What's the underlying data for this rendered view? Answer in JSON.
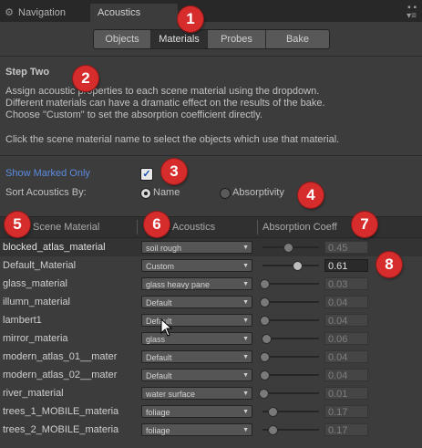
{
  "tabs": {
    "navigation": "Navigation",
    "acoustics": "Acoustics"
  },
  "toolbar": [
    "Objects",
    "Materials",
    "Probes",
    "Bake"
  ],
  "toolbar_selected": "Materials",
  "step": {
    "title": "Step Two",
    "lines": [
      "Assign acoustic properties to each scene material using the dropdown.",
      "Different materials can have a dramatic effect on the results of the bake.",
      "Choose \"Custom\" to set the absorption coefficient directly."
    ],
    "hint": "Click the scene material name to select the objects which use that material."
  },
  "options": {
    "show_marked_label": "Show Marked Only",
    "show_marked_checked": true,
    "sort_label": "Sort Acoustics By:",
    "sort_name": "Name",
    "sort_absorptivity": "Absorptivity",
    "sort_selected": "Name"
  },
  "columns": {
    "scene_material": "Scene Material",
    "acoustics": "Acoustics",
    "absorption": "Absorption Coeff"
  },
  "rows": [
    {
      "name": "blocked_atlas_material",
      "acoustics": "soil rough",
      "coeff": "0.45",
      "slider": 0.45,
      "editable": false,
      "selected": true
    },
    {
      "name": "Default_Material",
      "acoustics": "Custom",
      "coeff": "0.61",
      "slider": 0.61,
      "editable": true,
      "selected": false
    },
    {
      "name": "glass_material",
      "acoustics": "glass heavy pane",
      "coeff": "0.03",
      "slider": 0.03,
      "editable": false,
      "selected": false
    },
    {
      "name": "illumn_material",
      "acoustics": "Default",
      "coeff": "0.04",
      "slider": 0.04,
      "editable": false,
      "selected": false
    },
    {
      "name": "lambert1",
      "acoustics": "Default",
      "coeff": "0.04",
      "slider": 0.04,
      "editable": false,
      "selected": false
    },
    {
      "name": "mirror_materia",
      "acoustics": "glass",
      "coeff": "0.06",
      "slider": 0.06,
      "editable": false,
      "selected": false
    },
    {
      "name": "modern_atlas_01__mater",
      "acoustics": "Default",
      "coeff": "0.04",
      "slider": 0.04,
      "editable": false,
      "selected": false
    },
    {
      "name": "modern_atlas_02__mater",
      "acoustics": "Default",
      "coeff": "0.04",
      "slider": 0.04,
      "editable": false,
      "selected": false
    },
    {
      "name": "river_material",
      "acoustics": "water surface",
      "coeff": "0.01",
      "slider": 0.01,
      "editable": false,
      "selected": false
    },
    {
      "name": "trees_1_MOBILE_materia",
      "acoustics": "foliage",
      "coeff": "0.17",
      "slider": 0.17,
      "editable": false,
      "selected": false
    },
    {
      "name": "trees_2_MOBILE_materia",
      "acoustics": "foliage",
      "coeff": "0.17",
      "slider": 0.17,
      "editable": false,
      "selected": false
    }
  ],
  "callouts": [
    "1",
    "2",
    "3",
    "4",
    "5",
    "6",
    "7",
    "8"
  ],
  "colors": {
    "callout": "#d62c2c",
    "link": "#5b8be0",
    "panel": "#3c3c3c"
  }
}
